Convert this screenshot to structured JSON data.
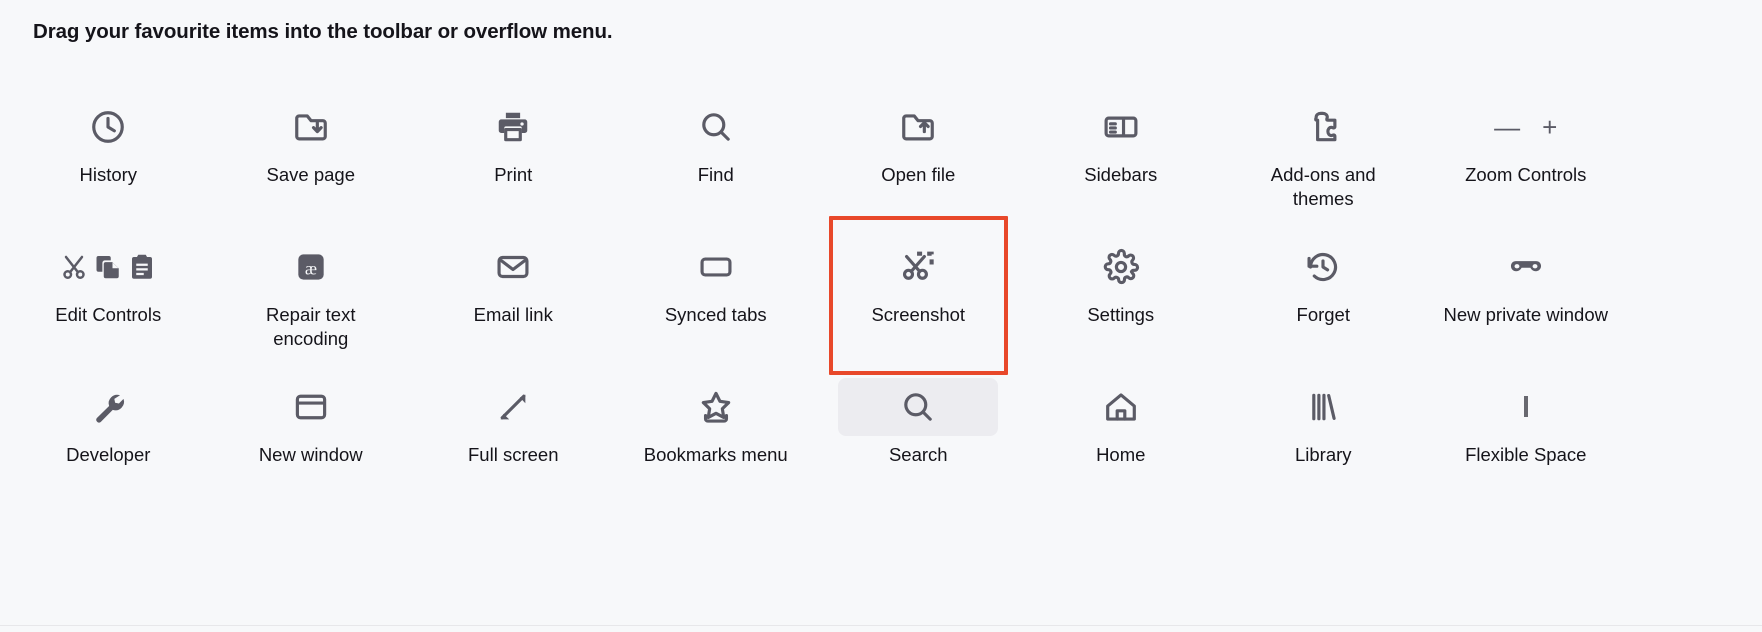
{
  "panel": {
    "title": "Drag your favourite items into the toolbar or overflow menu.",
    "background_color": "#f7f8fa",
    "highlight_color": "#e8482a",
    "hover_background_color": "#ececf0",
    "icon_color": "#5b5b66",
    "text_color": "#15141a"
  },
  "items": [
    {
      "label": "History",
      "icon": "clock-icon",
      "state": "normal"
    },
    {
      "label": "Save page",
      "icon": "save-page-icon",
      "state": "normal"
    },
    {
      "label": "Print",
      "icon": "printer-icon",
      "state": "normal"
    },
    {
      "label": "Find",
      "icon": "search-icon",
      "state": "normal"
    },
    {
      "label": "Open file",
      "icon": "open-file-icon",
      "state": "normal"
    },
    {
      "label": "Sidebars",
      "icon": "sidebars-icon",
      "state": "normal"
    },
    {
      "label": "Add-ons and themes",
      "icon": "puzzle-piece-icon",
      "state": "normal"
    },
    {
      "label": "Zoom Controls",
      "icon": "zoom-controls-icon",
      "state": "normal"
    },
    {
      "label": "Edit Controls",
      "icon": "cut-copy-paste-icon",
      "state": "normal"
    },
    {
      "label": "Repair text encoding",
      "icon": "text-encoding-icon",
      "state": "normal"
    },
    {
      "label": "Email link",
      "icon": "envelope-icon",
      "state": "normal"
    },
    {
      "label": "Synced tabs",
      "icon": "synced-tabs-icon",
      "state": "normal"
    },
    {
      "label": "Screenshot",
      "icon": "screenshot-scissors-icon",
      "state": "selected"
    },
    {
      "label": "Settings",
      "icon": "gear-icon",
      "state": "normal"
    },
    {
      "label": "Forget",
      "icon": "forget-clock-icon",
      "state": "normal"
    },
    {
      "label": "New private window",
      "icon": "private-mask-icon",
      "state": "normal"
    },
    {
      "label": "Developer",
      "icon": "wrench-icon",
      "state": "normal"
    },
    {
      "label": "New window",
      "icon": "window-icon",
      "state": "normal"
    },
    {
      "label": "Full screen",
      "icon": "fullscreen-arrows-icon",
      "state": "normal"
    },
    {
      "label": "Bookmarks menu",
      "icon": "bookmark-star-icon",
      "state": "normal"
    },
    {
      "label": "Search",
      "icon": "search-icon",
      "state": "hover"
    },
    {
      "label": "Home",
      "icon": "house-icon",
      "state": "normal"
    },
    {
      "label": "Library",
      "icon": "library-books-icon",
      "state": "normal"
    },
    {
      "label": "Flexible Space",
      "icon": "flexible-space-icon",
      "state": "normal"
    }
  ]
}
